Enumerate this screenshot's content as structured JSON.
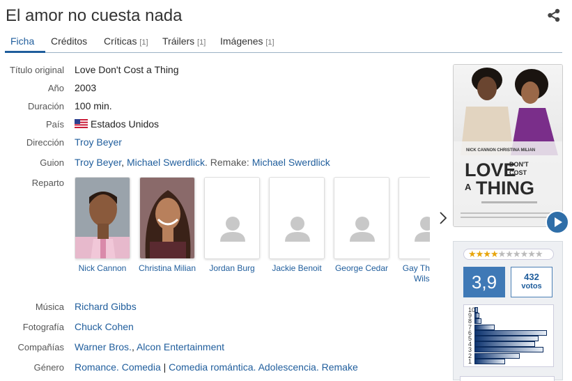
{
  "title": "El amor no cuesta nada",
  "tabs": [
    {
      "label": "Ficha",
      "count": ""
    },
    {
      "label": "Créditos",
      "count": ""
    },
    {
      "label": "Críticas",
      "count": "[1]"
    },
    {
      "label": "Tráilers",
      "count": "[1]"
    },
    {
      "label": "Imágenes",
      "count": "[1]"
    }
  ],
  "details": {
    "original_title_label": "Título original",
    "original_title": "Love Don't Cost a Thing",
    "year_label": "Año",
    "year": "2003",
    "duration_label": "Duración",
    "duration": "100 min.",
    "country_label": "País",
    "country": "Estados Unidos",
    "director_label": "Dirección",
    "director": "Troy Beyer",
    "script_label": "Guion",
    "script_1": "Troy Beyer",
    "script_sep": ", ",
    "script_2": "Michael Swerdlick",
    "script_remake_prefix": ". Remake: ",
    "script_remake": "Michael Swerdlick",
    "cast_label": "Reparto",
    "music_label": "Música",
    "music": "Richard Gibbs",
    "photo_label": "Fotografía",
    "photo": "Chuck Cohen",
    "companies_label": "Compañías",
    "company_1": "Warner Bros.",
    "company_sep": ", ",
    "company_2": "Alcon Entertainment",
    "genre_label": "Género",
    "genre_1": "Romance",
    "genre_2": "Comedia",
    "genre_pipe": " | ",
    "genre_3": "Comedia romántica",
    "genre_4": "Adolescencia",
    "genre_5": "Remake",
    "genre_dot": ". "
  },
  "cast": [
    {
      "name": "Nick Cannon"
    },
    {
      "name": "Christina Milian"
    },
    {
      "name": "Jordan Burg"
    },
    {
      "name": "Jackie Benoit"
    },
    {
      "name": "George Cedar"
    },
    {
      "name": "Gay Thomas Wilson"
    }
  ],
  "poster": {
    "names": "NICK CANNON  CHRISTINA MILIAN",
    "title_love": "LOVE",
    "title_dont": "DON'T",
    "title_cost": "COST",
    "title_a": "A",
    "title_thing": "THING"
  },
  "rating": {
    "average": "3,9",
    "votes": "432",
    "votes_label": "votos",
    "stars_filled": 4,
    "stars_total": 10,
    "histogram_labels": [
      "10",
      "9",
      "8",
      "7",
      "6",
      "5",
      "4",
      "3",
      "2",
      "1"
    ],
    "histogram_values": [
      2,
      3,
      4,
      12,
      43,
      38,
      36,
      41,
      27,
      18
    ]
  },
  "colors": {
    "accent": "#1f5d9c",
    "score_bg": "#3f79b6"
  }
}
